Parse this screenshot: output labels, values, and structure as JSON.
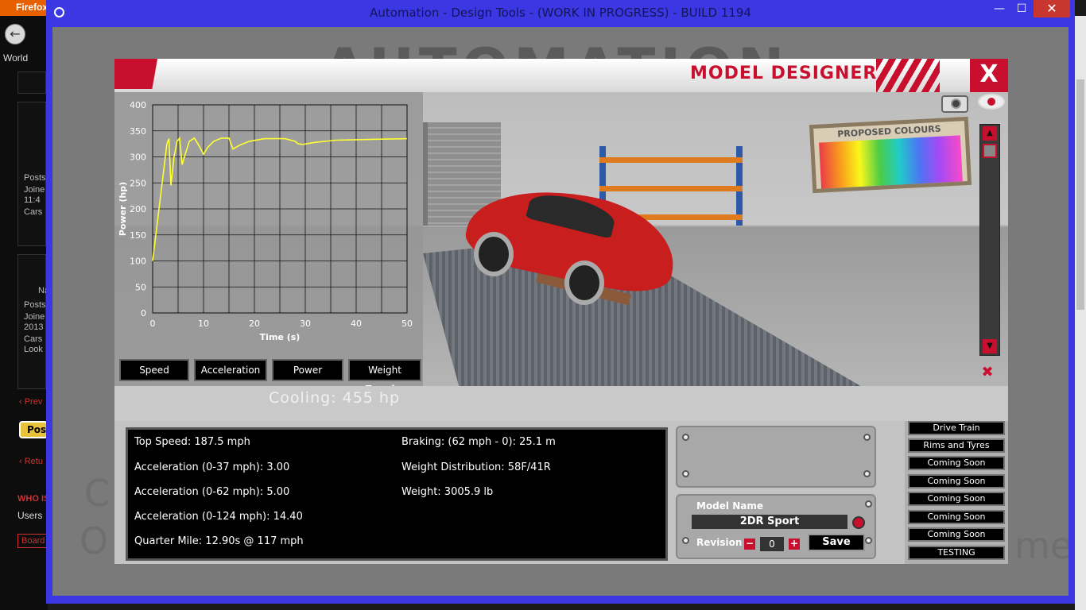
{
  "browser": {
    "tab_label": "Firefox",
    "bookmark_label": "World",
    "forum_lines_1": [
      "Posts",
      "Joine",
      "11:4",
      "Cars"
    ],
    "forum_lines_2": [
      "Na",
      "Posts",
      "Joine",
      "2013",
      "Cars",
      "Look"
    ],
    "prev_link": "‹ Prev",
    "post_button": "Post",
    "return_link": "‹ Retu",
    "who_is_label": "WHO IS",
    "users_label": "Users",
    "board_label": "Board"
  },
  "window": {
    "title": "Automation - Design Tools - (WORK IN PROGRESS) - BUILD 1194",
    "minimize": "—",
    "maximize": "☐",
    "close": "✕"
  },
  "background": {
    "logo_text": "AUTOMATION",
    "side_left_1": "C",
    "side_left_2": "O",
    "side_right": "me"
  },
  "designer": {
    "title": "MODEL DESIGNER",
    "close_label": "X",
    "colour_board_title": "PROPOSED COLOURS",
    "cooling": "Cooling: 455 hp"
  },
  "chart_tabs": [
    "Speed",
    "Acceleration",
    "Power",
    "Weight Transfer"
  ],
  "chart_data": {
    "type": "line",
    "xlabel": "Time (s)",
    "ylabel": "Power (hp)",
    "xlim": [
      0,
      50
    ],
    "ylim": [
      0,
      400
    ],
    "x_ticks": [
      0,
      10,
      20,
      30,
      40,
      50
    ],
    "y_ticks": [
      0,
      50,
      100,
      150,
      200,
      250,
      300,
      350,
      400
    ],
    "grid": true,
    "series": [
      {
        "color": "#ffff33",
        "x": [
          0,
          1,
          2,
          2.8,
          3.2,
          3.6,
          4.2,
          4.8,
          5.3,
          5.8,
          6.4,
          7.2,
          8.2,
          9.2,
          10,
          10.8,
          12,
          13.5,
          15,
          15.8,
          17,
          19,
          22,
          26,
          28,
          28.6,
          29.5,
          32,
          36,
          40,
          45,
          50
        ],
        "values": [
          100,
          180,
          260,
          325,
          335,
          245,
          300,
          330,
          336,
          285,
          305,
          330,
          336,
          320,
          305,
          318,
          330,
          336,
          336,
          315,
          322,
          330,
          335,
          335,
          330,
          325,
          324,
          328,
          332,
          333,
          334,
          335
        ]
      }
    ]
  },
  "stats": {
    "top_speed": "Top Speed: 187.5 mph",
    "accel_37": "Acceleration (0-37 mph): 3.00",
    "accel_62": "Acceleration (0-62 mph): 5.00",
    "accel_124": "Acceleration (0-124 mph): 14.40",
    "quarter_mile": "Quarter Mile: 12.90s @ 117 mph",
    "braking": "Braking: (62 mph - 0): 25.1 m",
    "weight_distribution": "Weight Distribution: 58F/41R",
    "weight": "Weight: 3005.9 lb"
  },
  "model": {
    "name_label": "Model Name",
    "name_value": "2DR Sport",
    "revision_label": "Revision",
    "revision_minus": "−",
    "revision_value": "0",
    "revision_plus": "+",
    "save_label": "Save"
  },
  "side_menu": [
    "Drive Train",
    "Rims and Tyres",
    "Coming Soon",
    "Coming Soon",
    "Coming Soon",
    "Coming Soon",
    "Coming Soon",
    "TESTING"
  ],
  "colors": {
    "accent_red": "#c8102e",
    "window_frame": "#3b37e3",
    "curve": "#ffff33"
  }
}
